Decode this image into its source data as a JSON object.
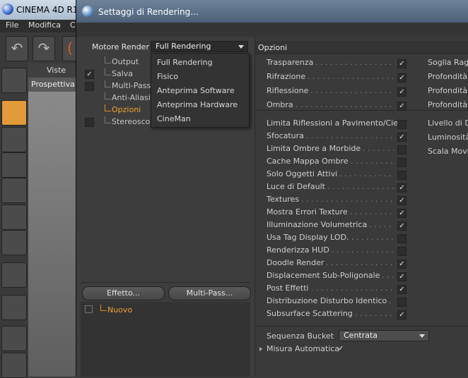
{
  "main_window": {
    "title": "CINEMA 4D R1",
    "menu": [
      "File",
      "Modifica",
      "C"
    ],
    "viewport": {
      "menu_label": "Viste",
      "tab_label": "Prospettiva"
    }
  },
  "dialog": {
    "title": "Settaggi di Rendering...",
    "engine": {
      "label": "Motore Render",
      "value": "Full Rendering"
    },
    "dropdown_options": [
      "Full Rendering",
      "Fisico",
      "Anteprima Software",
      "Anteprima Hardware",
      "CineMan"
    ],
    "tree": [
      {
        "label": "Output",
        "checked": null,
        "active": false
      },
      {
        "label": "Salva",
        "checked": true,
        "active": false
      },
      {
        "label": "Multi-Pass",
        "checked": false,
        "active": false
      },
      {
        "label": "Anti-Aliasing",
        "checked": null,
        "active": false
      },
      {
        "label": "Opzioni",
        "checked": null,
        "active": true
      },
      {
        "label": "Stereoscop",
        "checked": false,
        "active": false
      }
    ],
    "buttons": {
      "effect": "Effetto...",
      "multipass": "Multi-Pass..."
    },
    "preset": {
      "label": "Nuovo"
    },
    "options": {
      "header": "Opzioni",
      "group1": [
        {
          "label": "Trasparenza",
          "checked": true
        },
        {
          "label": "Rifrazione",
          "checked": true
        },
        {
          "label": "Riflessione",
          "checked": true
        },
        {
          "label": "Ombra",
          "checked": true
        }
      ],
      "group1_col2": [
        "Soglia Ragg",
        "Profondità",
        "Profondità",
        "Profondità"
      ],
      "group2": [
        {
          "label": "Limita Riflessioni a Pavimento/Cielo",
          "checked": false
        },
        {
          "label": "Sfocatura",
          "checked": true
        },
        {
          "label": "Limita Ombre a Morbide",
          "checked": false
        },
        {
          "label": "Cache Mappa Ombre",
          "checked": false
        },
        {
          "label": "Solo Oggetti Attivi",
          "checked": false
        },
        {
          "label": "Luce di Default",
          "checked": true
        },
        {
          "label": "Textures",
          "checked": true
        },
        {
          "label": "Mostra Errori Texture",
          "checked": true
        },
        {
          "label": "Illuminazione Volumetrica",
          "checked": true
        },
        {
          "label": "Usa Tag Display LOD.",
          "checked": false
        },
        {
          "label": "Renderizza HUD",
          "checked": false
        },
        {
          "label": "Doodle Render",
          "checked": true
        },
        {
          "label": "Displacement Sub-Poligonale",
          "checked": true
        },
        {
          "label": "Post Effetti",
          "checked": true
        },
        {
          "label": "Distribuzione Disturbo Identico",
          "checked": false
        },
        {
          "label": "Subsurface Scattering",
          "checked": true
        }
      ],
      "group2_col2": [
        "Livello di De",
        "Luminosità",
        "Scala Movin"
      ],
      "bucket": {
        "label": "Sequenza Bucket",
        "value": "Centrata"
      },
      "auto_size": {
        "label": "Misura Automatica",
        "checked": true
      }
    }
  }
}
